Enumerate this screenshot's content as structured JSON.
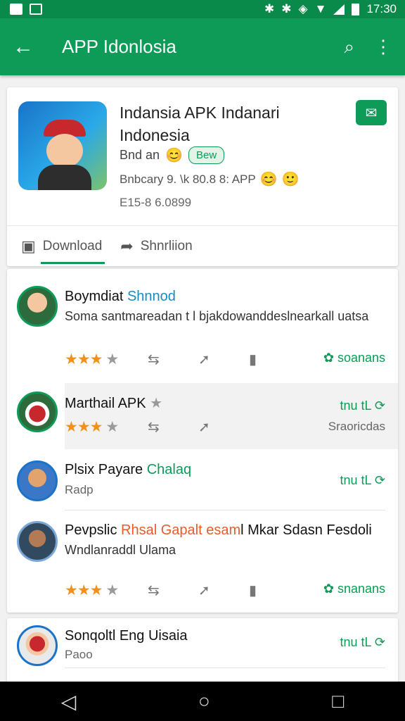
{
  "status_bar": {
    "time": "17:30"
  },
  "app_bar": {
    "title": "APP Idonlosia"
  },
  "app_card": {
    "title": "Indansia APK Indanari Indonesia",
    "subtitle": "Bnd an",
    "badge": "Bew",
    "line1": "Bnbcary 9. \\k 80.8 8: APP",
    "line2": "E15-8 6.0899",
    "tabs": [
      {
        "label": "Download",
        "icon": "download-icon"
      },
      {
        "label": "Shnrliion",
        "icon": "share-arrow-icon"
      }
    ]
  },
  "comments": [
    {
      "name": "Boymdiat",
      "name_tag": "Shnnod",
      "text": "Soma santmareadan t l bjakdowanddeslnearkall uatsa",
      "link": "soanans"
    },
    {
      "name": "Marthail APK",
      "right_top": "tnu tL",
      "right_bottom": "Sraoricdas"
    },
    {
      "name": "Plsix Payare",
      "name_tag": "Chalaq",
      "sub": "Radp",
      "right_top": "tnu tL"
    },
    {
      "name": "Pevpslic",
      "name_tag": "Rhsal Gapalt esam",
      "name_tail": "l Mkar Sdasn Fesdoli",
      "text": "Wndlanraddl Ulama",
      "link": "snanans"
    },
    {
      "name": "Sonqoltl Eng Uisaia",
      "sub": "Paoo",
      "right_top": "tnu tL"
    }
  ]
}
